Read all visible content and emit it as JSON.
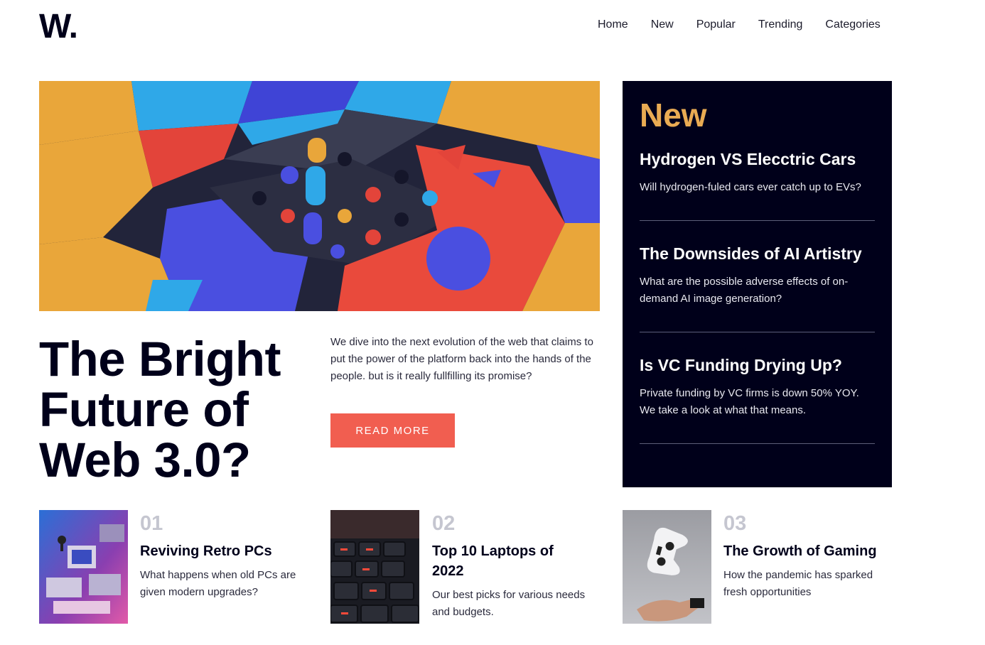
{
  "header": {
    "logo": "W.",
    "nav": [
      "Home",
      "New",
      "Popular",
      "Trending",
      "Categories"
    ]
  },
  "hero": {
    "image": "abstract-3d-blocks-image",
    "title_lines": [
      "The Bright",
      "Future of",
      "Web 3.0?"
    ],
    "description": "We dive into the next evolution of the web that claims to put the power of the platform back into the hands of the people. but is it really fullfilling its promise?",
    "cta": "READ MORE"
  },
  "new_panel": {
    "heading": "New",
    "items": [
      {
        "title": "Hydrogen VS Elecctric Cars",
        "text": "Will hydrogen-fuled cars ever catch up to EVs?"
      },
      {
        "title": "The Downsides of AI Artistry",
        "text": "What are the possible adverse effects of on-demand AI image generation?"
      },
      {
        "title": "Is VC Funding Drying Up?",
        "text": "Private funding by VC firms is down 50% YOY. We take a look at what that means."
      }
    ]
  },
  "cards": [
    {
      "num": "01",
      "title": "Reviving Retro PCs",
      "text": "What happens when old PCs are given modern upgrades?",
      "image": "retro-pcs-image"
    },
    {
      "num": "02",
      "title": "Top 10 Laptops of 2022",
      "text": "Our best picks for various needs and budgets.",
      "image": "laptop-keyboard-image"
    },
    {
      "num": "03",
      "title": "The Growth of Gaming",
      "text": "How the pandemic has sparked fresh opportunities",
      "image": "gamepad-image"
    }
  ],
  "colors": {
    "accent": "#f15e50",
    "new_heading": "#e9ab53",
    "dark": "#00001a",
    "number": "#c5c6d0"
  }
}
